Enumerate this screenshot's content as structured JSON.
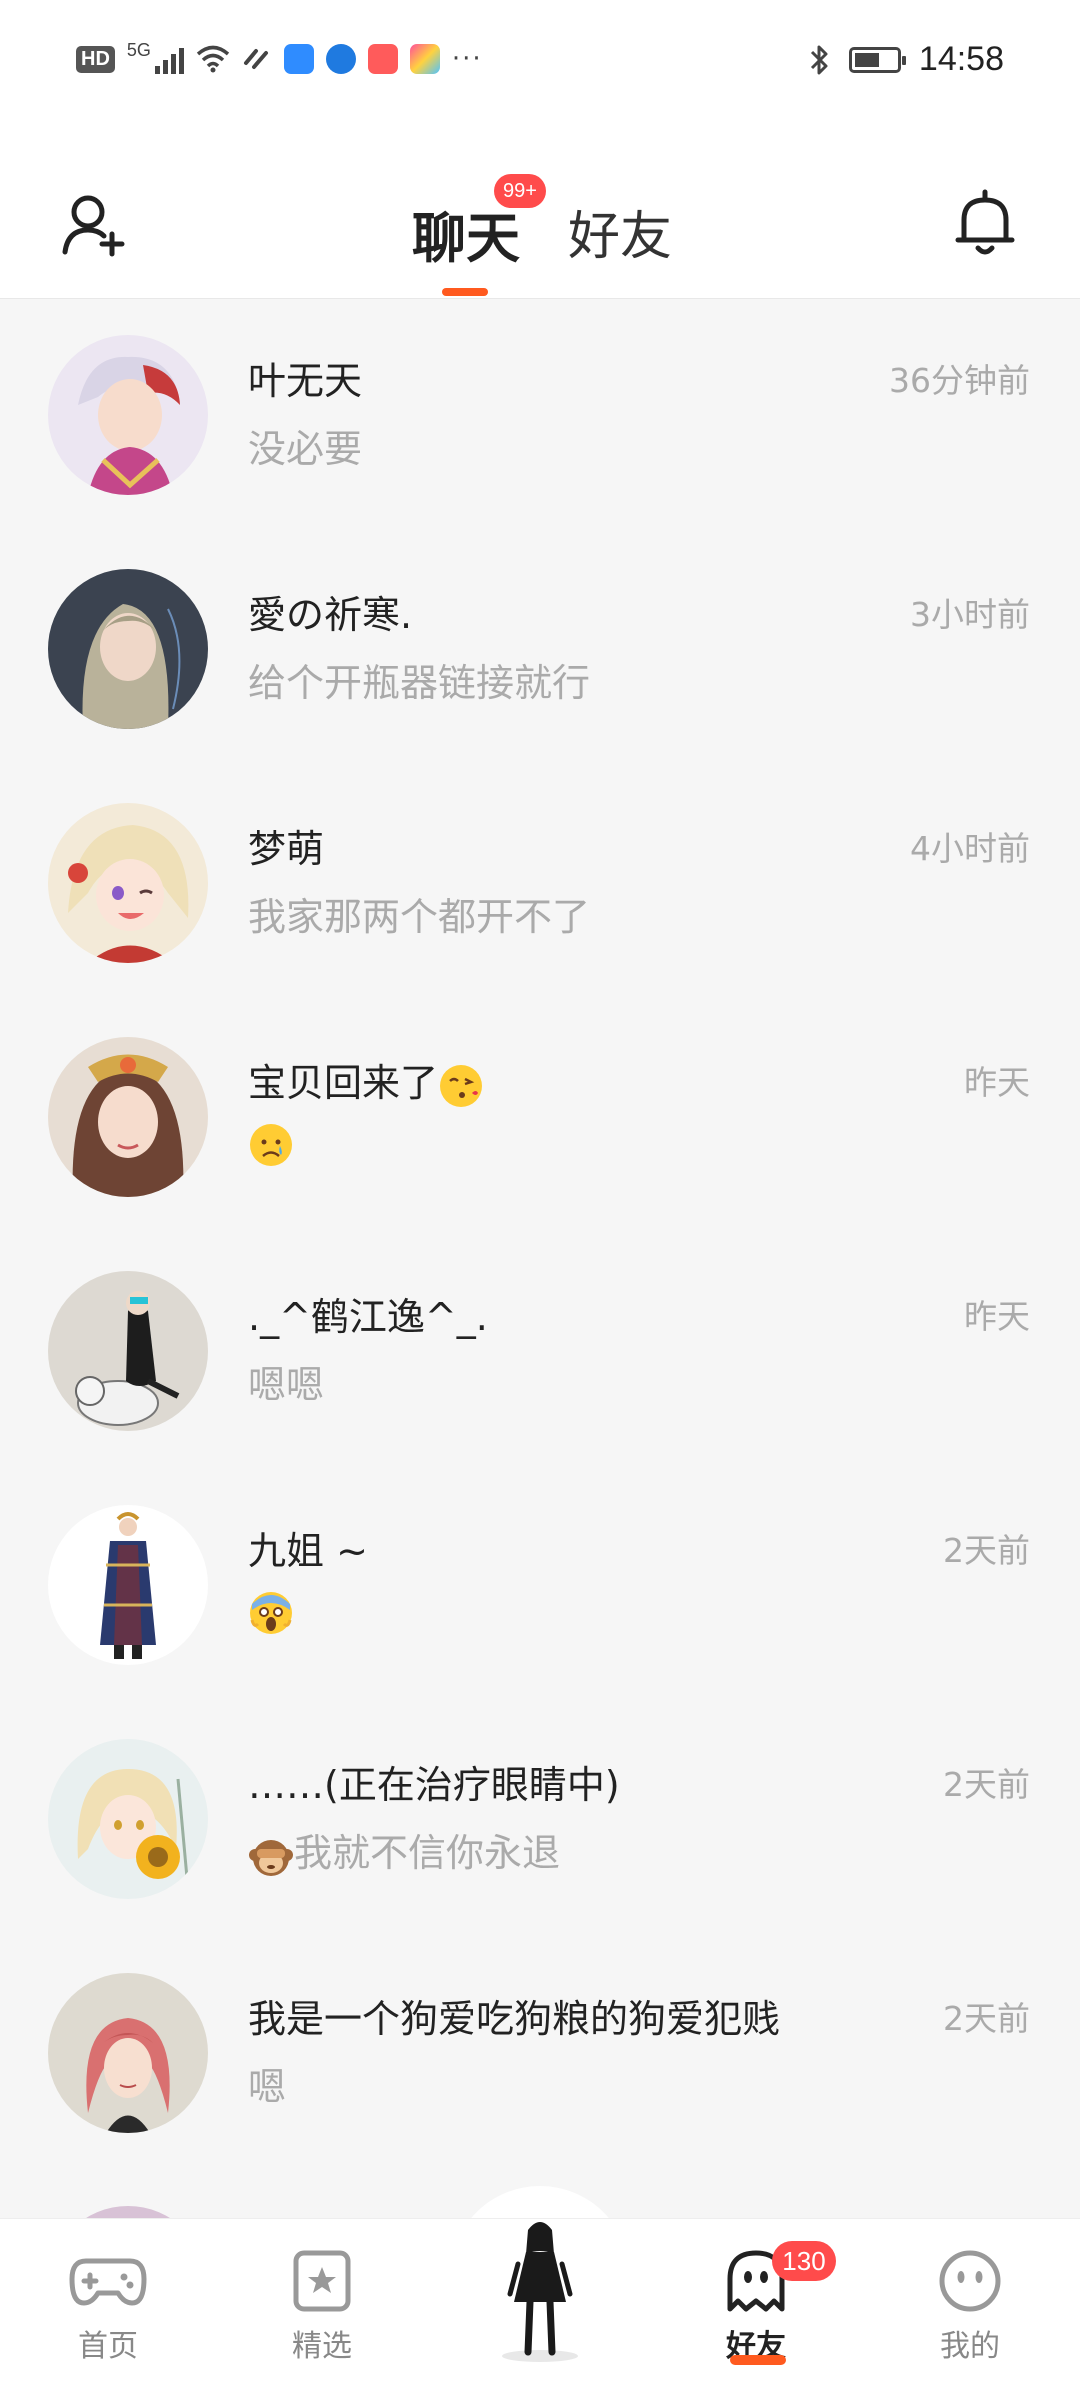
{
  "status_bar": {
    "left_label": "HD",
    "network": "5G",
    "time": "14:58",
    "more": "···",
    "battery_level": 0.6
  },
  "header": {
    "tabs": [
      {
        "label": "聊天",
        "active": true,
        "badge": "99+"
      },
      {
        "label": "好友",
        "active": false
      }
    ]
  },
  "chats": [
    {
      "name": "叶无天",
      "message": "没必要",
      "time": "36分钟前",
      "avatar": "anime-boy-white-red-hair"
    },
    {
      "name": "愛の祈寒.",
      "message": "给个开瓶器链接就行",
      "time": "3小时前",
      "avatar": "dark-girl-portrait"
    },
    {
      "name": "梦萌",
      "message": "我家那两个都开不了",
      "time": "4小时前",
      "avatar": "blonde-anime-girl"
    },
    {
      "name": "宝贝回来了",
      "name_emoji": "kissing-face",
      "message": "",
      "message_emoji": "crying-face",
      "time": "昨天",
      "avatar": "ancient-costume-girl"
    },
    {
      "name": "._^鹤江逸^_.",
      "message": "嗯嗯",
      "time": "昨天",
      "avatar": "figure-with-white-tiger"
    },
    {
      "name": "九姐 ~",
      "message": "",
      "message_emoji": "screaming-face",
      "time": "2天前",
      "avatar": "chinese-costume-figure"
    },
    {
      "name": "……(正在治疗眼睛中)",
      "message": "我就不信你永退",
      "message_emoji": "see-no-evil-monkey",
      "time": "2天前",
      "avatar": "anime-girl-sunflower"
    },
    {
      "name": "我是一个狗爱吃狗粮的狗爱犯贱",
      "message": "嗯",
      "time": "2天前",
      "avatar": "pink-hair-girl"
    }
  ],
  "bottom_nav": {
    "items": [
      {
        "label": "首页",
        "icon": "gamepad-icon",
        "active": false
      },
      {
        "label": "精选",
        "icon": "star-icon",
        "active": false
      },
      {
        "label": "好友",
        "icon": "ghost-icon",
        "active": true,
        "badge": "130"
      },
      {
        "label": "我的",
        "icon": "face-icon",
        "active": false
      }
    ]
  },
  "colors": {
    "accent": "#ff5a1f",
    "badge": "#ff4b4b",
    "background": "#f6f6f6",
    "muted_text": "#aaaaaa"
  }
}
